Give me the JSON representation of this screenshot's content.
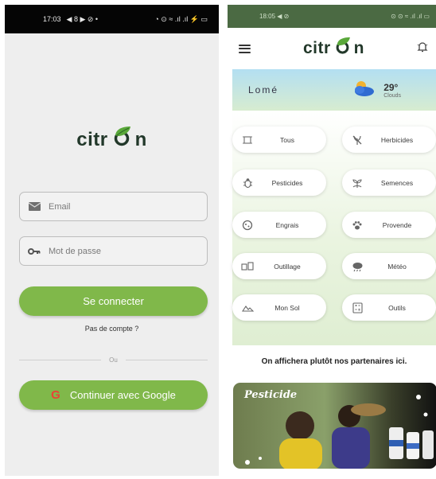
{
  "left_screen": {
    "status_bar": {
      "time": "17:03",
      "left_icons": "◀ 8 ▶ ⊘ •",
      "right_icons": "◔ ⊙ ≈ .ıl .ıl ⚡ ▭"
    },
    "logo_text": "citr",
    "logo_text_end": "n",
    "email_placeholder": "Email",
    "password_placeholder": "Mot de passe",
    "login_button": "Se connecter",
    "no_account_link": "Pas de compte ?",
    "divider_text": "Ou",
    "google_button": "Continuer avec Google"
  },
  "right_screen": {
    "status_bar": {
      "time": "18:05",
      "left_icons": "◀ ⊘",
      "right_icons": "⊙ ⊙ ≈ .ıl .ıl ▭"
    },
    "logo_text": "citr",
    "logo_text_end": "n",
    "weather": {
      "city": "Lomé",
      "temperature": "29°",
      "condition": "Clouds"
    },
    "categories": [
      {
        "label": "Tous",
        "icon": "grid-icon"
      },
      {
        "label": "Herbicides",
        "icon": "no-weed-icon"
      },
      {
        "label": "Pesticides",
        "icon": "bug-icon"
      },
      {
        "label": "Semences",
        "icon": "sprout-icon"
      },
      {
        "label": "Engrais",
        "icon": "fertilizer-icon"
      },
      {
        "label": "Provende",
        "icon": "paw-icon"
      },
      {
        "label": "Outillage",
        "icon": "tools-icon"
      },
      {
        "label": "Météo",
        "icon": "cloud-rain-icon"
      },
      {
        "label": "Mon Sol",
        "icon": "soil-icon"
      },
      {
        "label": "Outils",
        "icon": "calculator-icon"
      }
    ],
    "partners_text": "On affichera plutôt nos partenaires ici.",
    "banner_title": "Pesticide"
  },
  "colors": {
    "brand_green": "#80b84a",
    "logo_dark": "#22382a",
    "status_green": "#4b6a43"
  }
}
